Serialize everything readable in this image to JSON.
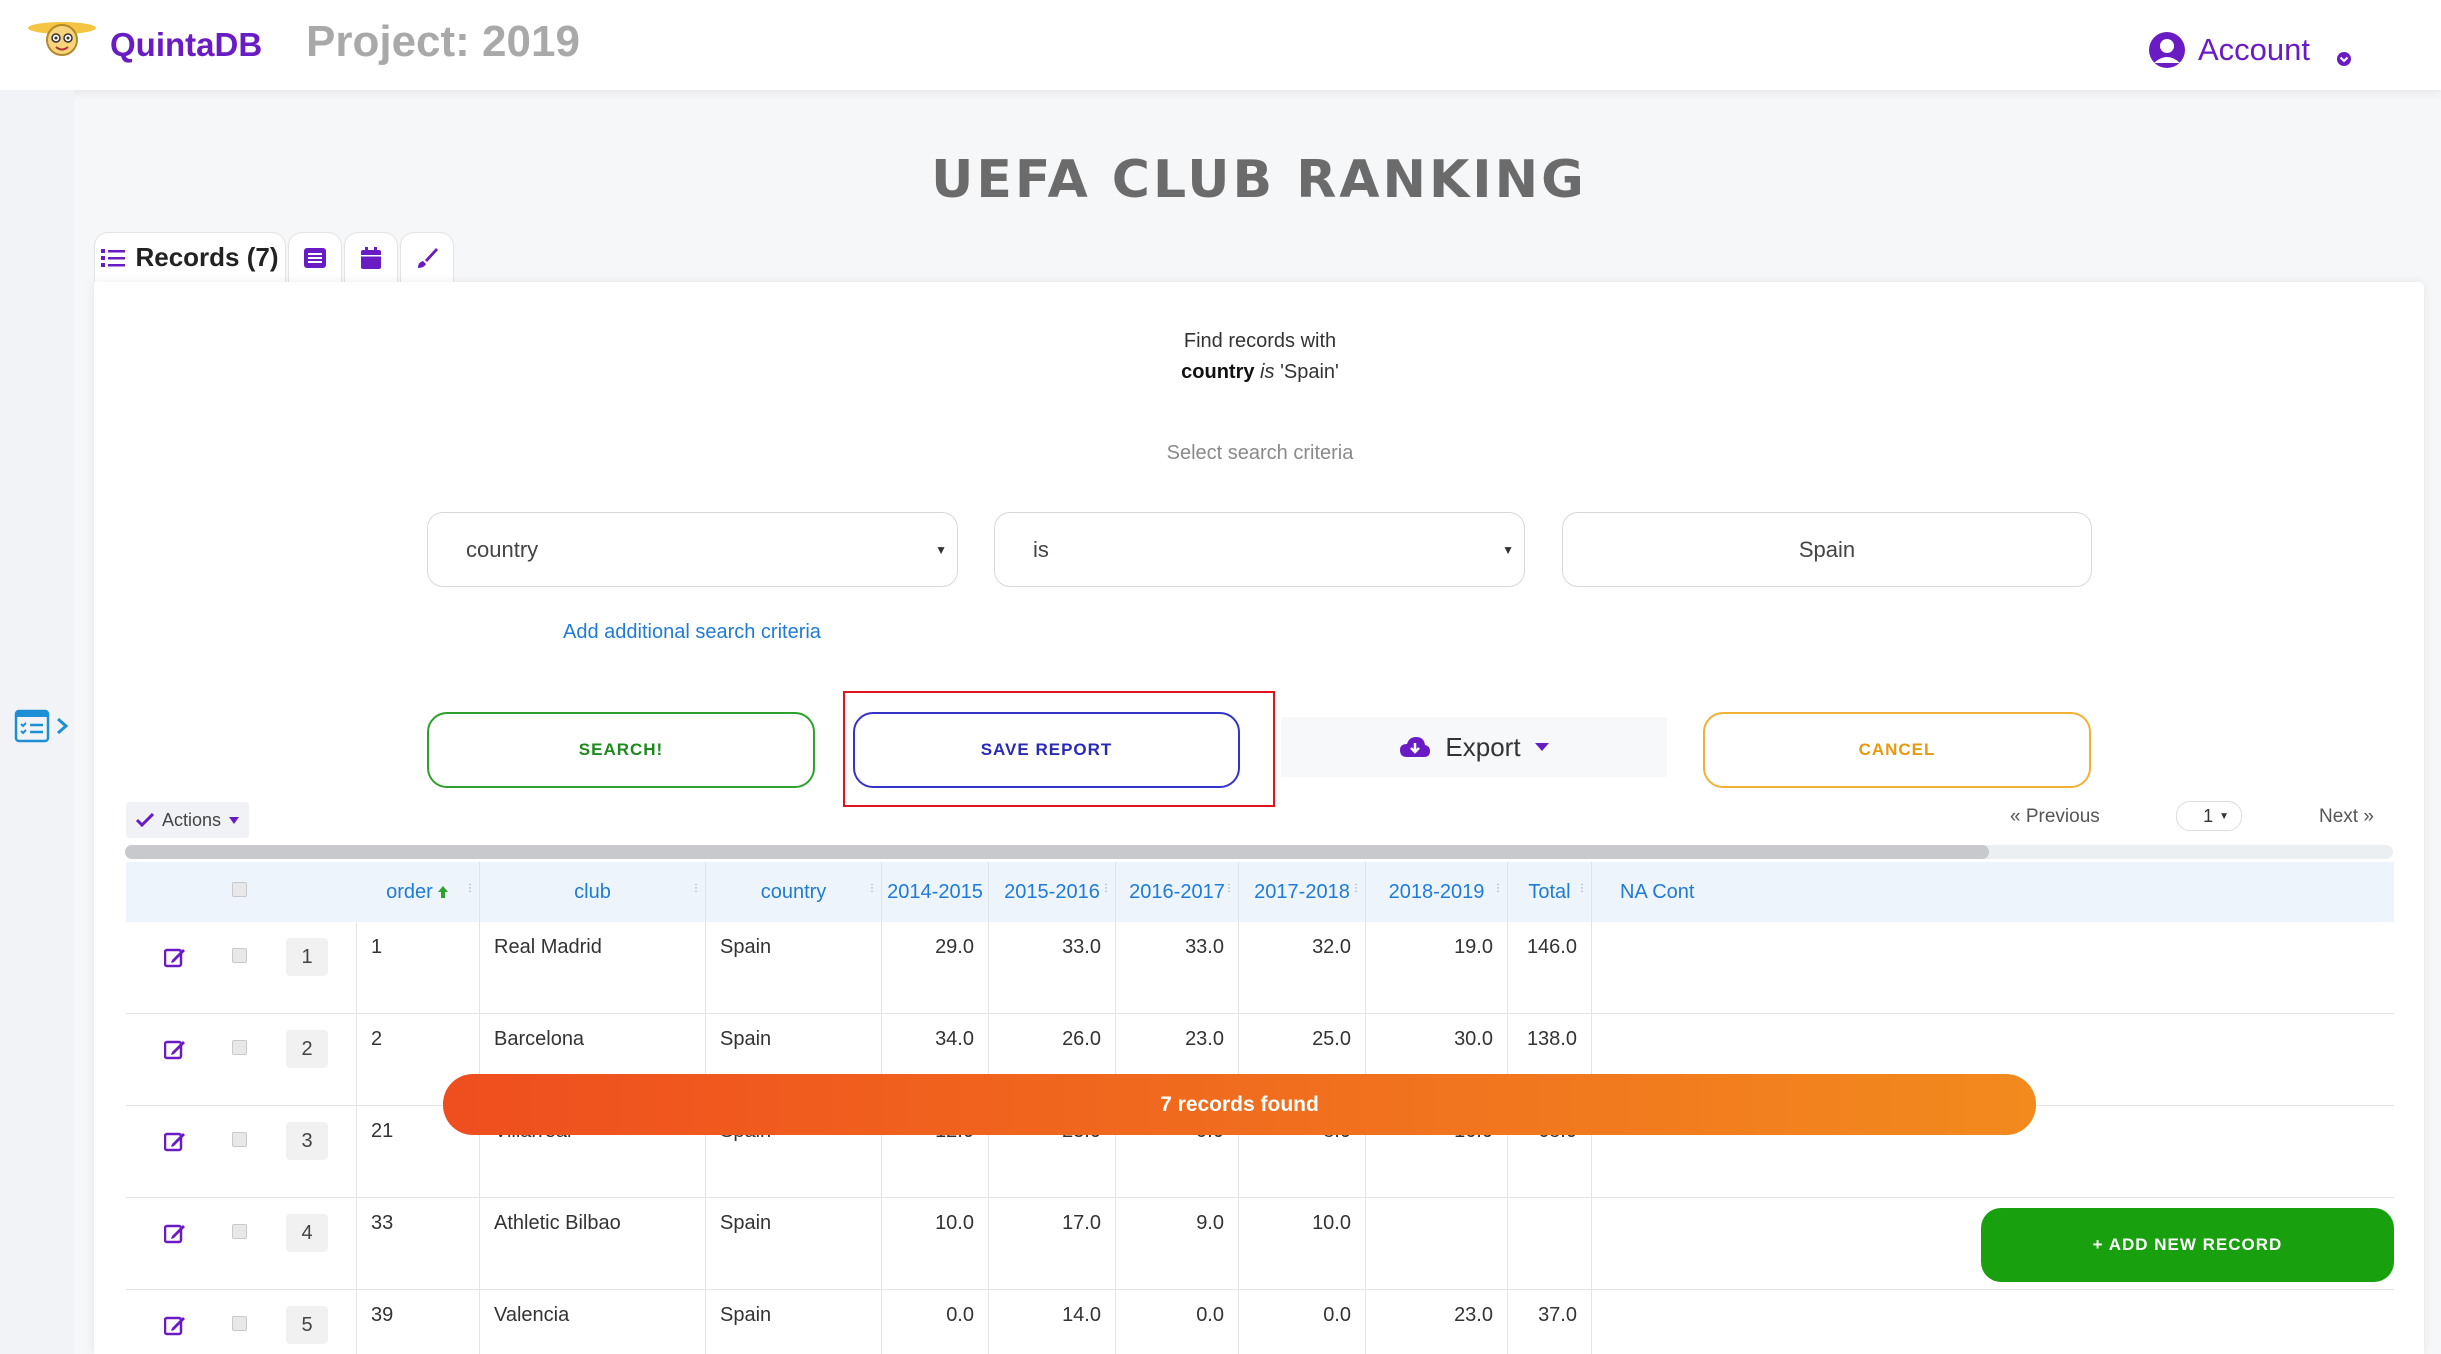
{
  "app": {
    "brand": "QuintaDB",
    "project_title": "Project: 2019",
    "account_label": "Account"
  },
  "page": {
    "title": "UEFA CLUB RANKING"
  },
  "tabs": {
    "records_label": "Records (7)"
  },
  "search": {
    "find_title": "Find records with",
    "field_name": "country",
    "operator_text": "is",
    "quoted_value": "'Spain'",
    "criteria_hint": "Select search criteria",
    "field_select": "country",
    "operator_select": "is",
    "value_input": "Spain",
    "add_criteria": "Add additional search criteria"
  },
  "buttons": {
    "search": "SEARCH!",
    "save_report": "SAVE REPORT",
    "export": "Export",
    "cancel": "CANCEL",
    "add_record": "+ ADD NEW RECORD"
  },
  "toolbar": {
    "actions": "Actions",
    "previous": "« Previous",
    "page": "1",
    "next": "Next »"
  },
  "table": {
    "columns": [
      "order",
      "club",
      "country",
      "2014-2015",
      "2015-2016",
      "2016-2017",
      "2017-2018",
      "2018-2019",
      "Total",
      "NA Cont"
    ],
    "rows": [
      {
        "n": "1",
        "order": "1",
        "club": "Real Madrid",
        "country": "Spain",
        "y1415": "29.0",
        "y1516": "33.0",
        "y1617": "33.0",
        "y1718": "32.0",
        "y1819": "19.0",
        "total": "146.0"
      },
      {
        "n": "2",
        "order": "2",
        "club": "Barcelona",
        "country": "Spain",
        "y1415": "34.0",
        "y1516": "26.0",
        "y1617": "23.0",
        "y1718": "25.0",
        "y1819": "30.0",
        "total": "138.0"
      },
      {
        "n": "3",
        "order": "21",
        "club": "Villarreal",
        "country": "Spain",
        "y1415": "12.0",
        "y1516": "23.0",
        "y1617": "9.0",
        "y1718": "8.0",
        "y1819": "16.0",
        "total": "68.0"
      },
      {
        "n": "4",
        "order": "33",
        "club": "Athletic Bilbao",
        "country": "Spain",
        "y1415": "10.0",
        "y1516": "17.0",
        "y1617": "9.0",
        "y1718": "10.0",
        "y1819": "",
        "total": ""
      },
      {
        "n": "5",
        "order": "39",
        "club": "Valencia",
        "country": "Spain",
        "y1415": "0.0",
        "y1516": "14.0",
        "y1617": "0.0",
        "y1718": "0.0",
        "y1819": "23.0",
        "total": "37.0"
      }
    ]
  },
  "status": {
    "toast": "7 records found"
  },
  "colors": {
    "brand_purple": "#6a1cc4",
    "link_blue": "#1e7bd6",
    "search_green": "#2ca12c",
    "save_blue": "#3434c8",
    "cancel_orange": "#f2b134",
    "toast_gradient_start": "#ef4e1e",
    "toast_gradient_end": "#f28a1e",
    "add_green": "#18a00e",
    "highlight_red": "#e0141b"
  },
  "icons": [
    "logo-mascot-icon",
    "user-circle-icon",
    "chevron-down-icon",
    "list-icon",
    "table-icon",
    "calendar-icon",
    "brush-icon",
    "checklist-icon",
    "chevron-right-icon",
    "cloud-download-icon",
    "caret-down-icon",
    "check-icon",
    "sort-up-icon",
    "edit-icon"
  ]
}
